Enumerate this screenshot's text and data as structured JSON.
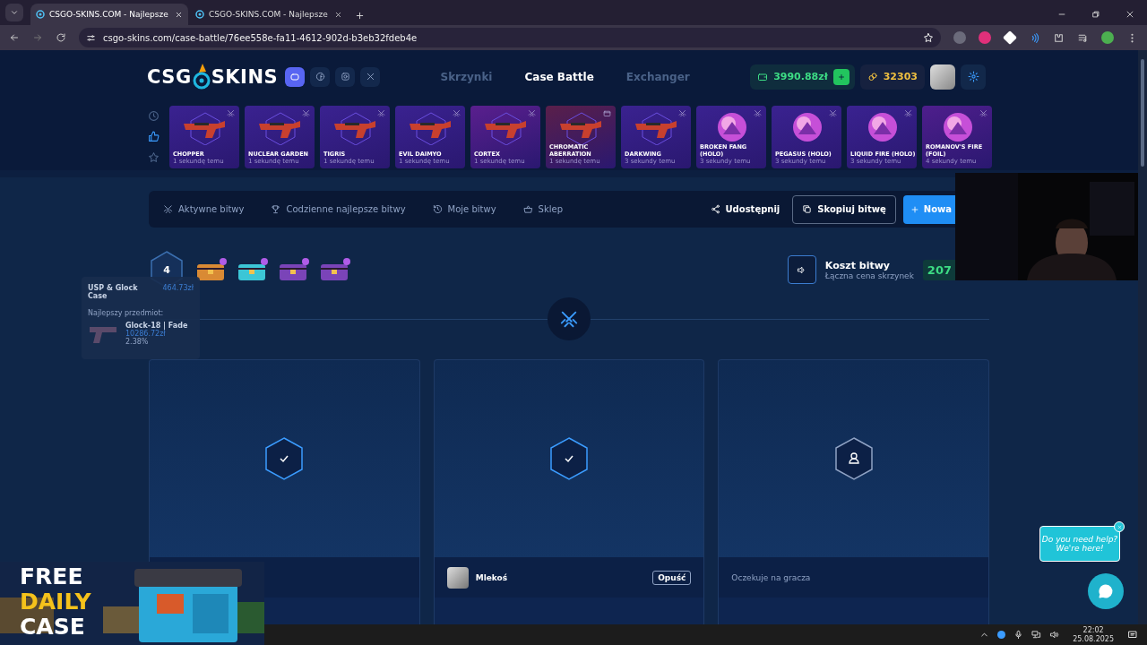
{
  "browser": {
    "tabs": [
      {
        "title": "CSGO-SKINS.COM - Najlepsze",
        "selected": true
      },
      {
        "title": "CSGO-SKINS.COM - Najlepsze",
        "selected": false
      }
    ],
    "url": "csgo-skins.com/case-battle/76ee558e-fa11-4612-902d-b3eb32fdeb4e"
  },
  "header": {
    "logo": [
      "CSG",
      "SKINS"
    ],
    "nav": [
      {
        "label": "Skrzynki",
        "selected": false
      },
      {
        "label": "Case Battle",
        "selected": true
      },
      {
        "label": "Exchanger",
        "selected": false
      }
    ],
    "balance": "3990.88zł",
    "coins": "32303"
  },
  "live_drops": {
    "filters": [
      {
        "kind": "clock",
        "selected": false
      },
      {
        "kind": "like",
        "selected": true
      },
      {
        "kind": "star",
        "selected": false
      }
    ],
    "items": [
      {
        "name": "CHOPPER",
        "time": "1 sekundę temu",
        "color": "#3a2290",
        "kind": "weapon"
      },
      {
        "name": "NUCLEAR GARDEN",
        "time": "1 sekundę temu",
        "color": "#3a2290",
        "kind": "weapon"
      },
      {
        "name": "TIGRIS",
        "time": "1 sekundę temu",
        "color": "#3a2290",
        "kind": "weapon"
      },
      {
        "name": "EVIL DAIMYO",
        "time": "1 sekundę temu",
        "color": "#3a2290",
        "kind": "weapon"
      },
      {
        "name": "CORTEX",
        "time": "1 sekundę temu",
        "color": "#5a1f8e",
        "kind": "weapon"
      },
      {
        "name": "CHROMATIC ABERRATION",
        "time": "1 sekundę temu",
        "color": "#5a1f4a",
        "kind": "case_weapon"
      },
      {
        "name": "DARKWING",
        "time": "3 sekundy temu",
        "color": "#3a2290",
        "kind": "weapon"
      },
      {
        "name": "BROKEN FANG (HOLO)",
        "time": "3 sekundy temu",
        "color": "#3a2290",
        "kind": "sticker"
      },
      {
        "name": "PEGASUS (HOLO)",
        "time": "3 sekundy temu",
        "color": "#3a2290",
        "kind": "sticker"
      },
      {
        "name": "LIQUID FIRE (HOLO)",
        "time": "3 sekundy temu",
        "color": "#3a2290",
        "kind": "sticker"
      },
      {
        "name": "ROMANOV'S FIRE (FOIL)",
        "time": "4 sekundy temu",
        "color": "#4e1e8c",
        "kind": "sticker"
      }
    ]
  },
  "battle_toolbar": {
    "links": [
      {
        "kind": "swords",
        "label": "Aktywne bitwy"
      },
      {
        "kind": "trophy",
        "label": "Codzienne najlepsze bitwy"
      },
      {
        "kind": "history",
        "label": "Moje bitwy"
      },
      {
        "kind": "basket",
        "label": "Sklep"
      }
    ],
    "share": "Udostępnij",
    "copy": "Skopiuj bitwę",
    "create": "Nowa"
  },
  "rounds": {
    "count": "4",
    "cases": [
      {
        "color": "#d98a34"
      },
      {
        "color": "#3cc6d6"
      },
      {
        "color": "#7a44b8"
      },
      {
        "color": "#7a44b8"
      }
    ]
  },
  "tooltip": {
    "case": "USP & Glock Case",
    "price": "464.73zł",
    "best_label": "Najlepszy przedmiot:",
    "item": "Glock-18 | Fade",
    "item_price": "10286.72zł",
    "chance": "2.38%"
  },
  "cost": {
    "title": "Koszt bitwy",
    "subtitle": "Łączna cena skrzynek",
    "value": "207"
  },
  "slots": [
    {
      "kind": "ready"
    },
    {
      "kind": "ready",
      "player": "Mlekoś",
      "action": "Opuść"
    },
    {
      "kind": "waiting",
      "text": "Oczekuje na gracza"
    }
  ],
  "chat": {
    "bubble": [
      "Do you need help?",
      "We're here!"
    ]
  },
  "promo": {
    "lines": [
      {
        "text": "FREE",
        "color": "#ffffff"
      },
      {
        "text": "DAILY",
        "color": "#f5c21b"
      },
      {
        "text": "CASE",
        "color": "#ffffff"
      }
    ]
  },
  "taskbar": {
    "time": "22:02",
    "date": "25.08.2025"
  }
}
